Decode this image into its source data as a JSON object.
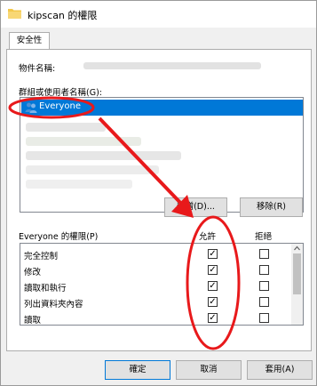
{
  "window": {
    "title": "kipscan 的權限"
  },
  "tabs": [
    {
      "label": "安全性"
    }
  ],
  "object_name": {
    "label": "物件名稱:"
  },
  "groups": {
    "label": "群組或使用者名稱(G):",
    "selected_item": "Everyone"
  },
  "buttons": {
    "add": "新增(D)...",
    "remove": "移除(R)",
    "ok": "確定",
    "cancel": "取消",
    "apply": "套用(A)"
  },
  "permissions": {
    "title": "Everyone 的權限(P)",
    "allow_header": "允許",
    "deny_header": "拒絕",
    "rows": [
      {
        "name": "完全控制",
        "allow": "✓",
        "deny": ""
      },
      {
        "name": "修改",
        "allow": "✓",
        "deny": ""
      },
      {
        "name": "讀取和執行",
        "allow": "✓",
        "deny": ""
      },
      {
        "name": "列出資料夾內容",
        "allow": "✓",
        "deny": ""
      },
      {
        "name": "讀取",
        "allow": "✓",
        "deny": ""
      }
    ]
  },
  "colors": {
    "selection": "#0078d7",
    "annotation": "#e8191b"
  },
  "icons": {
    "title": "folder-icon",
    "everyone": "user-group-icon"
  }
}
